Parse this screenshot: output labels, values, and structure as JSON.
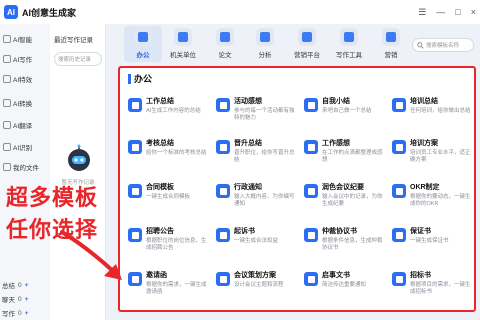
{
  "app": {
    "logo_text": "AI",
    "title": "AI创意生成家",
    "controls": [
      "☰",
      "—",
      "□",
      "×"
    ]
  },
  "sidebar": {
    "items": [
      {
        "label": "AI智能"
      },
      {
        "label": "AI写作"
      },
      {
        "label": "AI特效"
      },
      {
        "label": "AI转换"
      },
      {
        "label": "AI翻译"
      },
      {
        "label": "AI识别"
      },
      {
        "label": "我的文件"
      }
    ],
    "stats": [
      {
        "label": "总结",
        "value": "0",
        "plus": "+"
      },
      {
        "label": "聊天",
        "value": "0",
        "plus": "+"
      },
      {
        "label": "写作",
        "value": "0",
        "plus": "+"
      }
    ]
  },
  "history": {
    "title": "最近写作记录",
    "search_placeholder": "搜索历史记录",
    "empty_caption": "暂无写作记录"
  },
  "categories": [
    {
      "label": "办公",
      "active": true
    },
    {
      "label": "机关单位",
      "active": false
    },
    {
      "label": "论文",
      "active": false
    },
    {
      "label": "分析",
      "active": false
    },
    {
      "label": "营销平台",
      "active": false
    },
    {
      "label": "写作工具",
      "active": false
    },
    {
      "label": "营销",
      "active": false
    }
  ],
  "search": {
    "placeholder": "搜索模板名称"
  },
  "section": {
    "title": "办公"
  },
  "cards": [
    {
      "name": "工作总结",
      "desc": "AI生成工作内容的总结"
    },
    {
      "name": "活动感想",
      "desc": "参与的每一个活动都有独特的魅力"
    },
    {
      "name": "自我小结",
      "desc": "来吧自己做一个总结"
    },
    {
      "name": "培训总结",
      "desc": "任何培训，给你做出总结"
    },
    {
      "name": "考核总结",
      "desc": "给你一个标准的考核总结"
    },
    {
      "name": "晋升总结",
      "desc": "晋升职位，给你写晋升总结"
    },
    {
      "name": "工作感想",
      "desc": "在工作的点滴都整理成感想"
    },
    {
      "name": "培训方案",
      "desc": "培训员工专业水平，适正确方案"
    },
    {
      "name": "合同模板",
      "desc": "一键生成合同模板"
    },
    {
      "name": "行政通知",
      "desc": "输入大概内容，为你编写通知"
    },
    {
      "name": "润色会议纪要",
      "desc": "输入会议中的记录，为你生成纪要"
    },
    {
      "name": "OKR制定",
      "desc": "根据你的要动态，一键生成你的OKR"
    },
    {
      "name": "招聘公告",
      "desc": "根据职位的岗位信息，生成招聘公告"
    },
    {
      "name": "起诉书",
      "desc": "一键生成合法权益"
    },
    {
      "name": "仲裁协议书",
      "desc": "根据条件信息，生成仲裁协议书"
    },
    {
      "name": "保证书",
      "desc": "一键生成保证书"
    },
    {
      "name": "邀请函",
      "desc": "根据你的需求，一键生成邀请函"
    },
    {
      "name": "会议策划方案",
      "desc": "设计会议主题和流程"
    },
    {
      "name": "启事文书",
      "desc": "简洁传达重要通知"
    },
    {
      "name": "招标书",
      "desc": "根据项目的需求，一键生成招标书"
    }
  ],
  "overlay": {
    "line1": "超多模板",
    "line2": "任你选择"
  }
}
